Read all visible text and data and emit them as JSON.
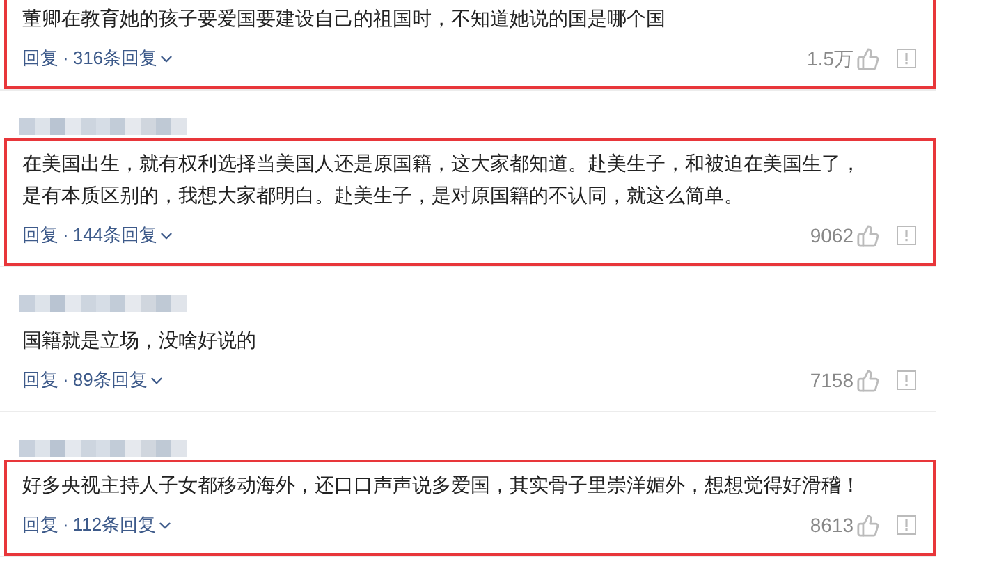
{
  "comments": [
    {
      "blurred_name": false,
      "highlighted": true,
      "lines": [
        "董卿在教育她的孩子要爱国要建设自己的祖国时，不知道她说的国是哪个国"
      ],
      "reply": "回复",
      "separator": "·",
      "replies": "316条回复",
      "likes": "1.5万"
    },
    {
      "blurred_name": true,
      "highlighted": true,
      "lines": [
        "在美国出生，就有权利选择当美国人还是原国籍，这大家都知道。赴美生子，和被迫在美国生了，",
        "是有本质区别的，我想大家都明白。赴美生子，是对原国籍的不认同，就这么简单。"
      ],
      "reply": "回复",
      "separator": "·",
      "replies": "144条回复",
      "likes": "9062"
    },
    {
      "blurred_name": true,
      "highlighted": false,
      "lines": [
        "国籍就是立场，没啥好说的"
      ],
      "reply": "回复",
      "separator": "·",
      "replies": "89条回复",
      "likes": "7158"
    },
    {
      "blurred_name": true,
      "highlighted": true,
      "lines": [
        "好多央视主持人子女都移动海外，还口口声声说多爱国，其实骨子里崇洋媚外，想想觉得好滑稽！"
      ],
      "reply": "回复",
      "separator": "·",
      "replies": "112条回复",
      "likes": "8613"
    }
  ]
}
